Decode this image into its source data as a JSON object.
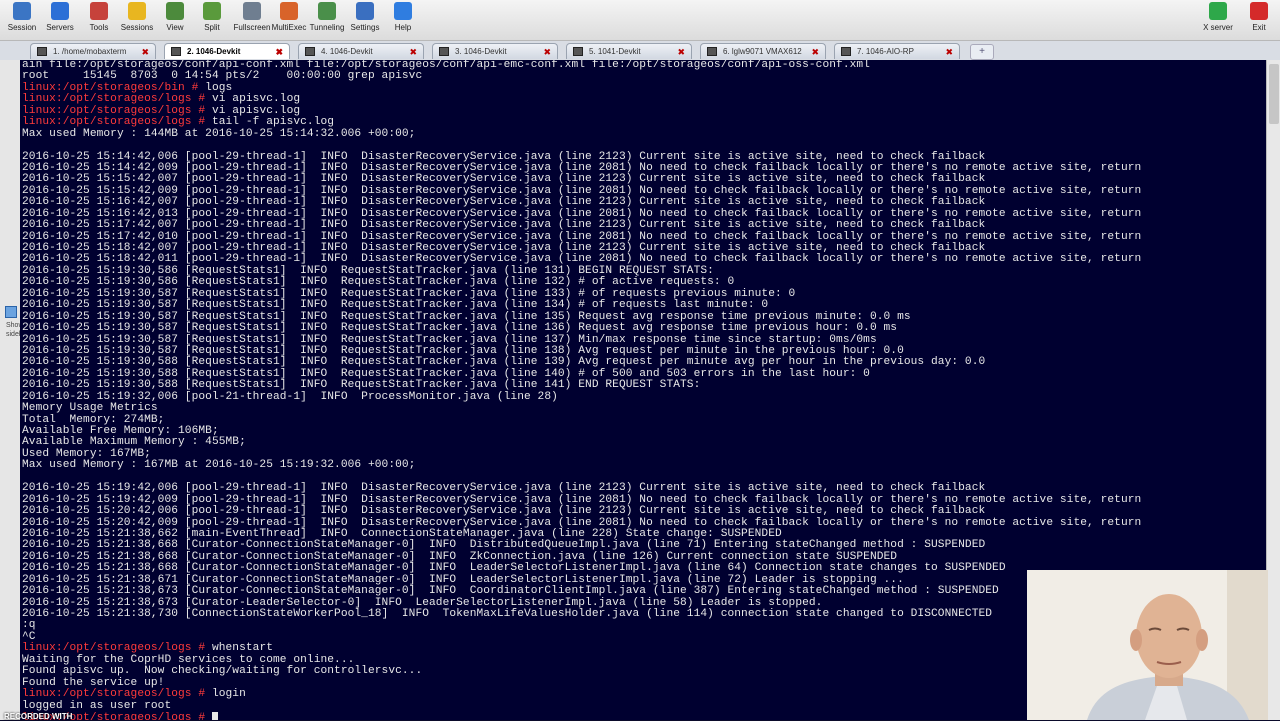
{
  "toolbar": {
    "buttons": [
      {
        "label": "Session",
        "color": "#3b75c4"
      },
      {
        "label": "Servers",
        "color": "#2c6fd6"
      },
      {
        "label": "Tools",
        "color": "#c6423b"
      },
      {
        "label": "Sessions",
        "color": "#e8b620"
      },
      {
        "label": "View",
        "color": "#4c8a3c"
      },
      {
        "label": "Split",
        "color": "#5a9a3c"
      },
      {
        "label": "Fullscreen",
        "color": "#6f7e90"
      },
      {
        "label": "MultiExec",
        "color": "#d8632a"
      },
      {
        "label": "Tunneling",
        "color": "#4a8f4a"
      },
      {
        "label": "Settings",
        "color": "#3a6fc0"
      },
      {
        "label": "Help",
        "color": "#2f7de0"
      }
    ],
    "xserver_label": "X server",
    "exit_label": "Exit"
  },
  "tabs": [
    {
      "label": "1. /home/mobaxterm",
      "active": false
    },
    {
      "label": "2. 1046-Devkit",
      "active": true
    },
    {
      "label": "4. 1046-Devkit",
      "active": false
    },
    {
      "label": "3. 1046-Devkit",
      "active": false
    },
    {
      "label": "5. 1041-Devkit",
      "active": false
    },
    {
      "label": "6. lglw9071 VMAX612",
      "active": false
    },
    {
      "label": "7. 1046-AIO-RP",
      "active": false
    }
  ],
  "sidebar": {
    "handle_text": "Show sidebar"
  },
  "terminal": {
    "lines": [
      {
        "t": "ain file:/opt/storageos/conf/api-conf.xml file:/opt/storageos/conf/api-emc-conf.xml file:/opt/storageos/conf/api-oss-conf.xml"
      },
      {
        "t": "root     15145  8703  0 14:54 pts/2    00:00:00 grep apisvc"
      },
      {
        "p": "linux:/opt/storageos/bin #",
        "t": " logs"
      },
      {
        "p": "linux:/opt/storageos/logs #",
        "t": " vi apisvc.log"
      },
      {
        "p": "linux:/opt/storageos/logs #",
        "t": " vi apisvc.log"
      },
      {
        "p": "linux:/opt/storageos/logs #",
        "t": " tail -f apisvc.log"
      },
      {
        "t": "Max used Memory : 144MB at 2016-10-25 15:14:32.006 +00:00;"
      },
      {
        "t": ""
      },
      {
        "t": "2016-10-25 15:14:42,006 [pool-29-thread-1]  INFO  DisasterRecoveryService.java (line 2123) Current site is active site, need to check failback"
      },
      {
        "t": "2016-10-25 15:14:42,009 [pool-29-thread-1]  INFO  DisasterRecoveryService.java (line 2081) No need to check failback locally or there's no remote active site, return"
      },
      {
        "t": "2016-10-25 15:15:42,007 [pool-29-thread-1]  INFO  DisasterRecoveryService.java (line 2123) Current site is active site, need to check failback"
      },
      {
        "t": "2016-10-25 15:15:42,009 [pool-29-thread-1]  INFO  DisasterRecoveryService.java (line 2081) No need to check failback locally or there's no remote active site, return"
      },
      {
        "t": "2016-10-25 15:16:42,007 [pool-29-thread-1]  INFO  DisasterRecoveryService.java (line 2123) Current site is active site, need to check failback"
      },
      {
        "t": "2016-10-25 15:16:42,013 [pool-29-thread-1]  INFO  DisasterRecoveryService.java (line 2081) No need to check failback locally or there's no remote active site, return"
      },
      {
        "t": "2016-10-25 15:17:42,007 [pool-29-thread-1]  INFO  DisasterRecoveryService.java (line 2123) Current site is active site, need to check failback"
      },
      {
        "t": "2016-10-25 15:17:42,010 [pool-29-thread-1]  INFO  DisasterRecoveryService.java (line 2081) No need to check failback locally or there's no remote active site, return"
      },
      {
        "t": "2016-10-25 15:18:42,007 [pool-29-thread-1]  INFO  DisasterRecoveryService.java (line 2123) Current site is active site, need to check failback"
      },
      {
        "t": "2016-10-25 15:18:42,011 [pool-29-thread-1]  INFO  DisasterRecoveryService.java (line 2081) No need to check failback locally or there's no remote active site, return"
      },
      {
        "t": "2016-10-25 15:19:30,586 [RequestStats1]  INFO  RequestStatTracker.java (line 131) BEGIN REQUEST STATS:"
      },
      {
        "t": "2016-10-25 15:19:30,586 [RequestStats1]  INFO  RequestStatTracker.java (line 132) # of active requests: 0"
      },
      {
        "t": "2016-10-25 15:19:30,587 [RequestStats1]  INFO  RequestStatTracker.java (line 133) # of requests previous minute: 0"
      },
      {
        "t": "2016-10-25 15:19:30,587 [RequestStats1]  INFO  RequestStatTracker.java (line 134) # of requests last minute: 0"
      },
      {
        "t": "2016-10-25 15:19:30,587 [RequestStats1]  INFO  RequestStatTracker.java (line 135) Request avg response time previous minute: 0.0 ms"
      },
      {
        "t": "2016-10-25 15:19:30,587 [RequestStats1]  INFO  RequestStatTracker.java (line 136) Request avg response time previous hour: 0.0 ms"
      },
      {
        "t": "2016-10-25 15:19:30,587 [RequestStats1]  INFO  RequestStatTracker.java (line 137) Min/max response time since startup: 0ms/0ms"
      },
      {
        "t": "2016-10-25 15:19:30,587 [RequestStats1]  INFO  RequestStatTracker.java (line 138) Avg request per minute in the previous hour: 0.0"
      },
      {
        "t": "2016-10-25 15:19:30,588 [RequestStats1]  INFO  RequestStatTracker.java (line 139) Avg request per minute avg per hour in the previous day: 0.0"
      },
      {
        "t": "2016-10-25 15:19:30,588 [RequestStats1]  INFO  RequestStatTracker.java (line 140) # of 500 and 503 errors in the last hour: 0"
      },
      {
        "t": "2016-10-25 15:19:30,588 [RequestStats1]  INFO  RequestStatTracker.java (line 141) END REQUEST STATS:"
      },
      {
        "t": "2016-10-25 15:19:32,006 [pool-21-thread-1]  INFO  ProcessMonitor.java (line 28)"
      },
      {
        "t": "Memory Usage Metrics"
      },
      {
        "t": "Total  Memory: 274MB;"
      },
      {
        "t": "Available Free Memory: 106MB;"
      },
      {
        "t": "Available Maximum Memory : 455MB;"
      },
      {
        "t": "Used Memory: 167MB;"
      },
      {
        "t": "Max used Memory : 167MB at 2016-10-25 15:19:32.006 +00:00;"
      },
      {
        "t": ""
      },
      {
        "t": "2016-10-25 15:19:42,006 [pool-29-thread-1]  INFO  DisasterRecoveryService.java (line 2123) Current site is active site, need to check failback"
      },
      {
        "t": "2016-10-25 15:19:42,009 [pool-29-thread-1]  INFO  DisasterRecoveryService.java (line 2081) No need to check failback locally or there's no remote active site, return"
      },
      {
        "t": "2016-10-25 15:20:42,006 [pool-29-thread-1]  INFO  DisasterRecoveryService.java (line 2123) Current site is active site, need to check failback"
      },
      {
        "t": "2016-10-25 15:20:42,009 [pool-29-thread-1]  INFO  DisasterRecoveryService.java (line 2081) No need to check failback locally or there's no remote active site, return"
      },
      {
        "t": "2016-10-25 15:21:38,662 [main-EventThread]  INFO  ConnectionStateManager.java (line 228) State change: SUSPENDED"
      },
      {
        "t": "2016-10-25 15:21:38,668 [Curator-ConnectionStateManager-0]  INFO  DistributedQueueImpl.java (line 71) Entering stateChanged method : SUSPENDED"
      },
      {
        "t": "2016-10-25 15:21:38,668 [Curator-ConnectionStateManager-0]  INFO  ZkConnection.java (line 126) Current connection state SUSPENDED"
      },
      {
        "t": "2016-10-25 15:21:38,668 [Curator-ConnectionStateManager-0]  INFO  LeaderSelectorListenerImpl.java (line 64) Connection state changes to SUSPENDED"
      },
      {
        "t": "2016-10-25 15:21:38,671 [Curator-ConnectionStateManager-0]  INFO  LeaderSelectorListenerImpl.java (line 72) Leader is stopping ..."
      },
      {
        "t": "2016-10-25 15:21:38,673 [Curator-ConnectionStateManager-0]  INFO  CoordinatorClientImpl.java (line 387) Entering stateChanged method : SUSPENDED"
      },
      {
        "t": "2016-10-25 15:21:38,673 [Curator-LeaderSelector-0]  INFO  LeaderSelectorListenerImpl.java (line 58) Leader is stopped."
      },
      {
        "t": "2016-10-25 15:21:38,730 [ConnectionStateWorkerPool_18]  INFO  TokenMaxLifeValuesHolder.java (line 114) connection state changed to DISCONNECTED"
      },
      {
        "t": ":q"
      },
      {
        "t": "^C"
      },
      {
        "p": "linux:/opt/storageos/logs #",
        "t": " whenstart"
      },
      {
        "t": "Waiting for the CoprHD services to come online..."
      },
      {
        "t": "Found apisvc up.  Now checking/waiting for controllersvc..."
      },
      {
        "t": "Found the service up!"
      },
      {
        "p": "linux:/opt/storageos/logs #",
        "t": " login"
      },
      {
        "t": "logged in as user root"
      },
      {
        "p": "linux:/opt/storageos/logs #",
        "t": " ",
        "cursor": true
      }
    ]
  },
  "overlay": {
    "caption": "RECORDED WITH"
  }
}
